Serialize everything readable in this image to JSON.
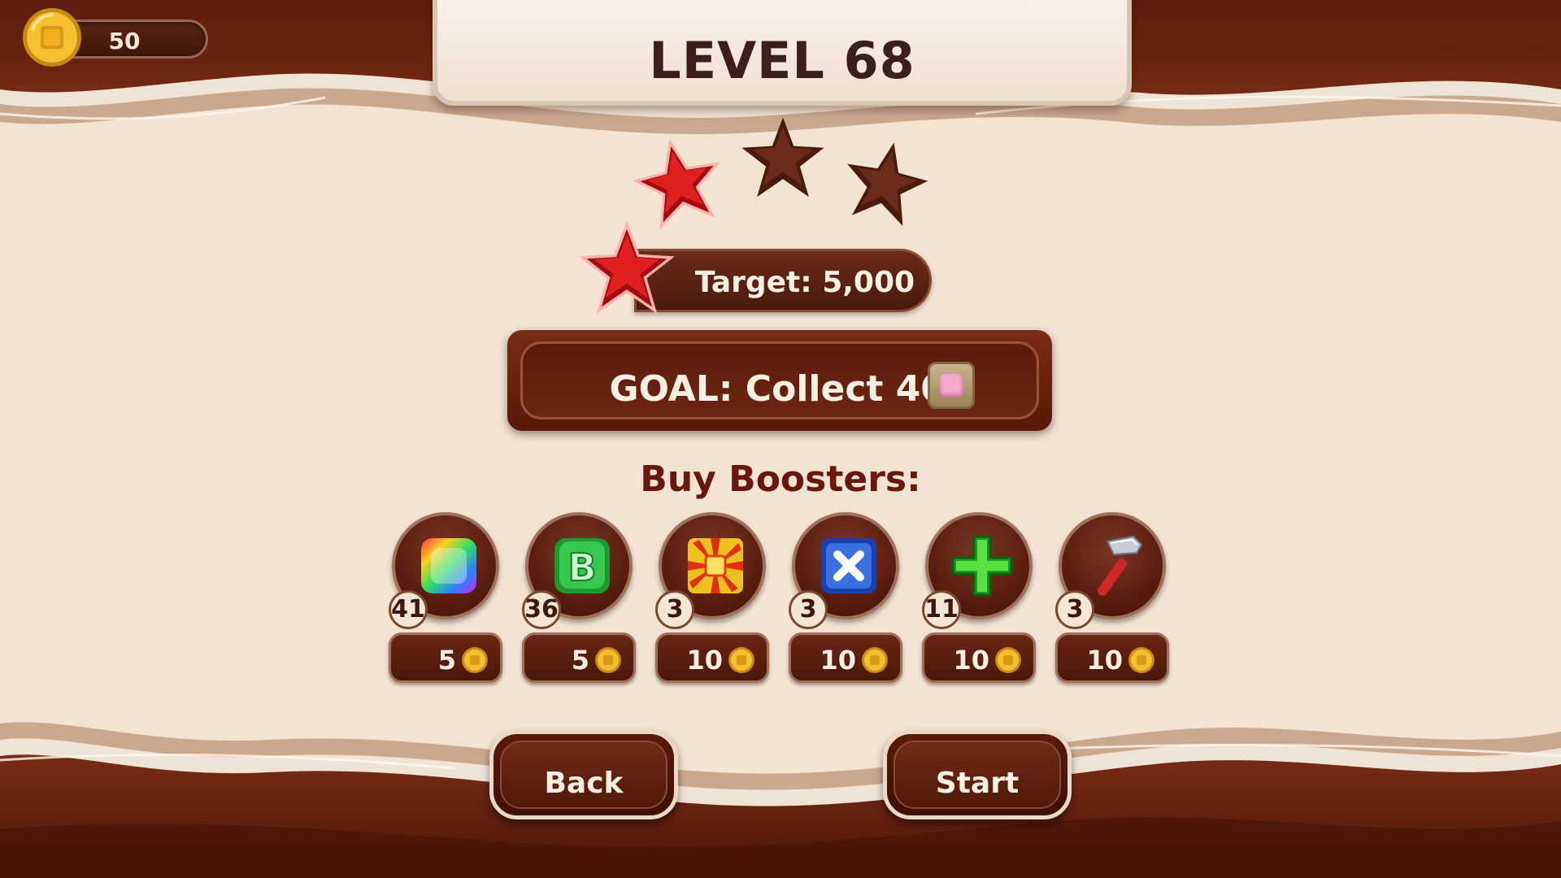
{
  "hud": {
    "coins": "50",
    "coin_icon": "gold-coin-icon"
  },
  "level": {
    "title": "LEVEL 68"
  },
  "stars": {
    "earned": 1,
    "total": 3
  },
  "target": {
    "text": "Target: 5,000"
  },
  "goal": {
    "text": "GOAL: Collect 40",
    "item_icon": "pink-candy-icon"
  },
  "boosters": {
    "title": "Buy Boosters:",
    "items": [
      {
        "icon": "rainbow-candy-icon",
        "count": "41",
        "price": "5"
      },
      {
        "icon": "green-b-block-icon",
        "count": "36",
        "price": "5"
      },
      {
        "icon": "explosion-block-icon",
        "count": "3",
        "price": "10"
      },
      {
        "icon": "blue-x-block-icon",
        "count": "3",
        "price": "10"
      },
      {
        "icon": "green-plus-icon",
        "count": "11",
        "price": "10"
      },
      {
        "icon": "hammer-icon",
        "count": "3",
        "price": "10"
      }
    ]
  },
  "buttons": {
    "back": "Back",
    "start": "Start"
  },
  "colors": {
    "chocolate": "#5a1e0e",
    "cream": "#f2e3d3",
    "gold": "#f0b820",
    "star_red": "#d2141a"
  }
}
